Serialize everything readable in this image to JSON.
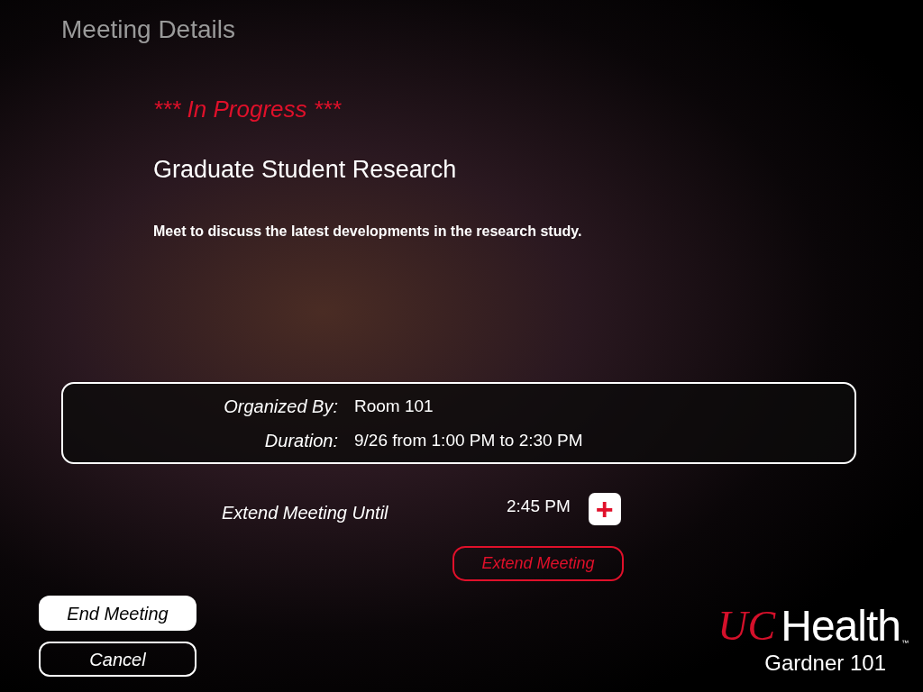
{
  "header": {
    "title": "Meeting Details"
  },
  "meeting": {
    "status": "*** In Progress ***",
    "name": "Graduate Student Research",
    "description": "Meet to discuss the latest developments in the research study."
  },
  "details": [
    {
      "label": "Organized By:",
      "value": "Room 101"
    },
    {
      "label": "Duration:",
      "value": "9/26 from 1:00 PM to 2:30 PM"
    }
  ],
  "extend": {
    "label": "Extend Meeting Until",
    "time": "2:45 PM",
    "plus": "+",
    "button": "Extend Meeting"
  },
  "actions": [
    {
      "label": "End Meeting",
      "kind": "primary"
    },
    {
      "label": "Cancel",
      "kind": "outline"
    }
  ],
  "branding": {
    "mark": "UC",
    "name": "Health",
    "trademark": "™",
    "room": "Gardner 101"
  }
}
